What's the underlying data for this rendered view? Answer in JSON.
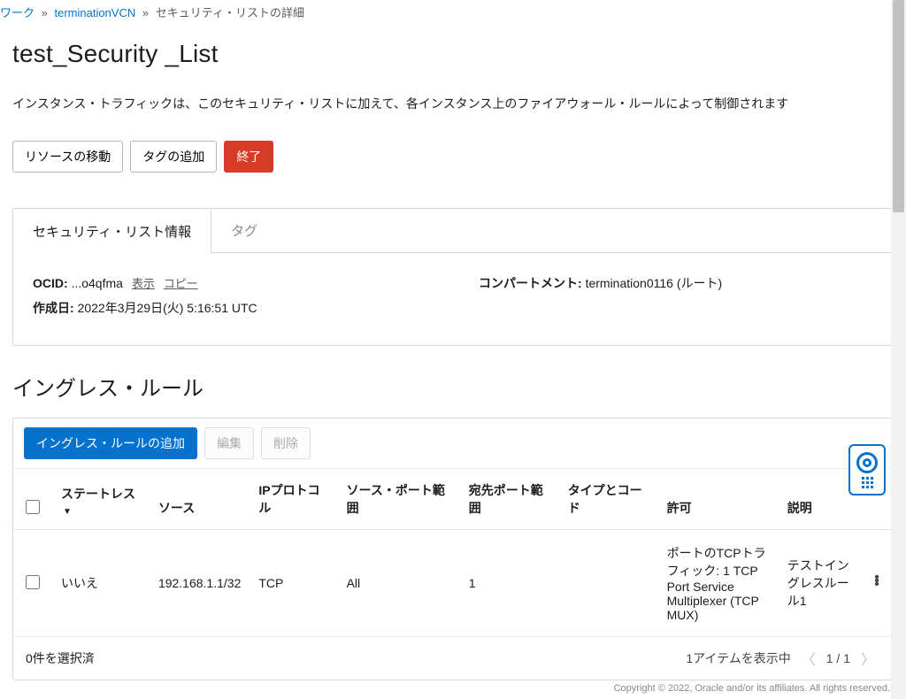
{
  "breadcrumb": {
    "items": [
      "ワーク",
      "terminationVCN"
    ],
    "last": "セキュリティ・リストの詳細"
  },
  "page_title": "test_Security _List",
  "description": "インスタンス・トラフィックは、このセキュリティ・リストに加えて、各インスタンス上のファイアウォール・ルールによって制御されます",
  "buttons": {
    "move_resource": "リソースの移動",
    "add_tag": "タグの追加",
    "terminate": "終了"
  },
  "tabs": {
    "info": "セキュリティ・リスト情報",
    "tags": "タグ"
  },
  "info": {
    "ocid_label": "OCID:",
    "ocid_value": "...o4qfma",
    "show": "表示",
    "copy": "コピー",
    "created_label": "作成日:",
    "created_value": "2022年3月29日(火) 5:16:51 UTC",
    "compartment_label": "コンパートメント:",
    "compartment_value": "termination0116 (ルート)"
  },
  "ingress": {
    "heading": "イングレス・ルール",
    "add_rule": "イングレス・ルールの追加",
    "edit": "編集",
    "delete": "削除",
    "headers": {
      "stateless": "ステートレス",
      "source": "ソース",
      "ip_protocol": "IPプロトコル",
      "src_port": "ソース・ポート範囲",
      "dst_port": "宛先ポート範囲",
      "type_code": "タイプとコード",
      "allow": "許可",
      "desc": "説明"
    },
    "rows": [
      {
        "stateless": "いいえ",
        "source": "192.168.1.1/32",
        "ip_protocol": "TCP",
        "src_port": "All",
        "dst_port": "1",
        "type_code": "",
        "allow": "ポートのTCPトラフィック: 1 TCP Port Service Multiplexer (TCP MUX)",
        "desc": "テストイングレスルール1"
      }
    ],
    "footer_selected": "0件を選択済",
    "footer_showing": "1アイテムを表示中",
    "pager": "1 / 1"
  },
  "copyright": "Copyright © 2022, Oracle and/or its affiliates. All rights reserved."
}
